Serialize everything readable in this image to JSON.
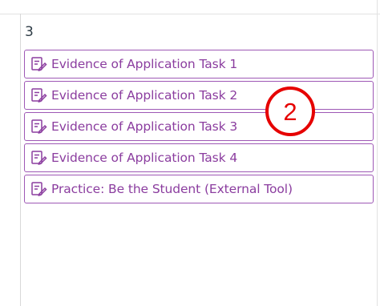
{
  "calendar": {
    "day_number": "3",
    "events": [
      {
        "label": "Evidence of Application Task 1",
        "icon": "assignment-icon"
      },
      {
        "label": "Evidence of Application Task 2",
        "icon": "assignment-icon"
      },
      {
        "label": "Evidence of Application Task 3",
        "icon": "assignment-icon"
      },
      {
        "label": "Evidence of Application Task 4",
        "icon": "assignment-icon"
      },
      {
        "label": "Practice: Be the Student (External Tool)",
        "icon": "assignment-icon"
      }
    ]
  },
  "annotation": {
    "marker_number": "2",
    "marker_color": "#e60000"
  },
  "colors": {
    "event_accent": "#8b3d9f",
    "event_border": "#9e58b5"
  }
}
